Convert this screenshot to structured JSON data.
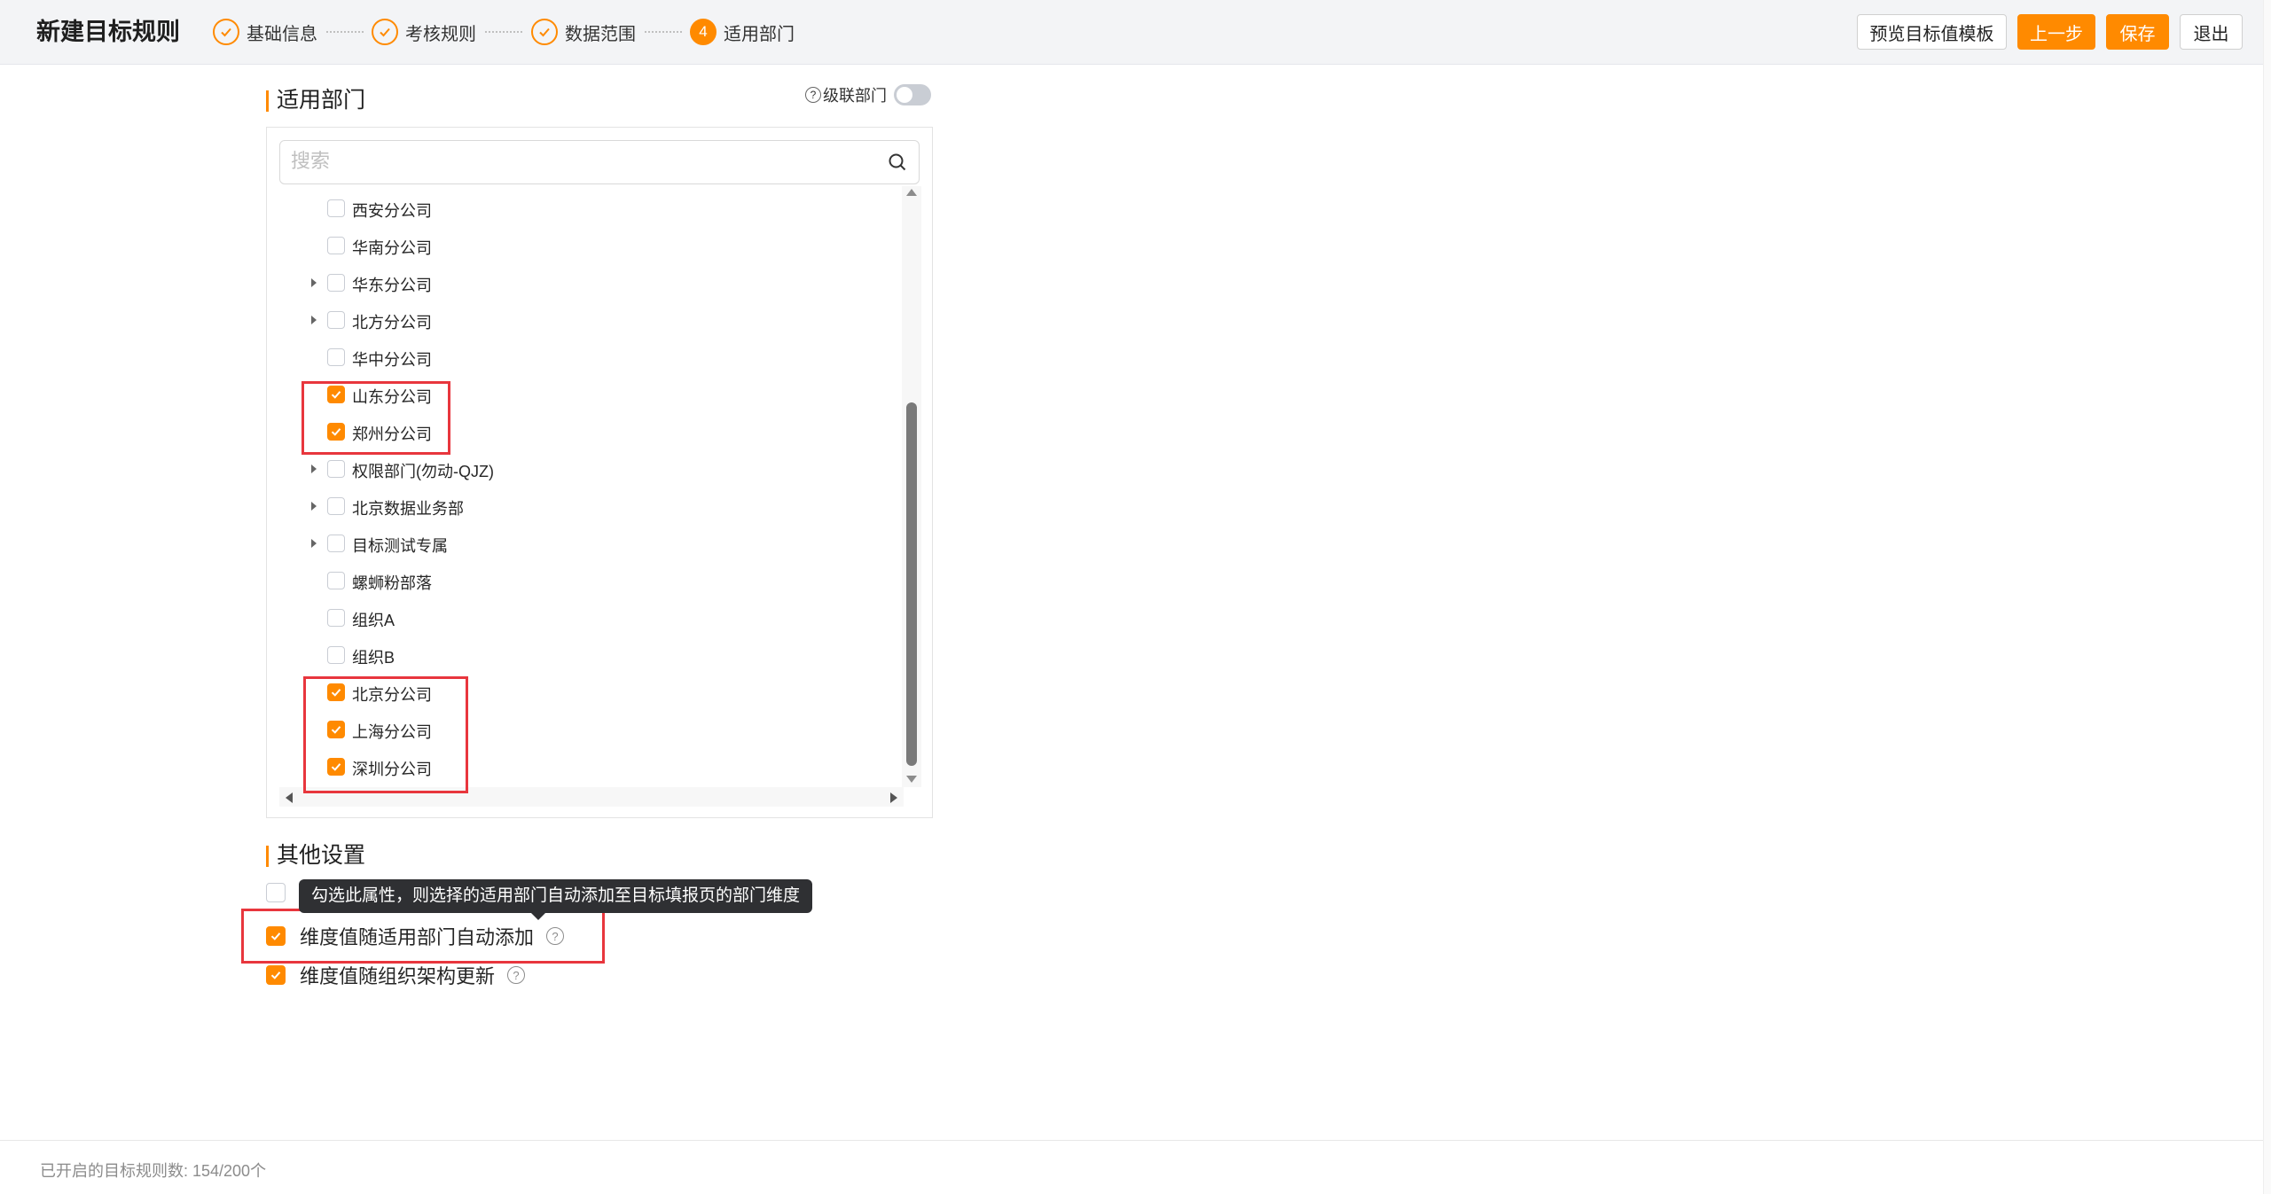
{
  "header": {
    "title": "新建目标规则",
    "steps": [
      {
        "label": "基础信息",
        "state": "done"
      },
      {
        "label": "考核规则",
        "state": "done"
      },
      {
        "label": "数据范围",
        "state": "done"
      },
      {
        "label": "适用部门",
        "state": "active",
        "number": "4"
      }
    ],
    "buttons": {
      "preview": "预览目标值模板",
      "prev": "上一步",
      "save": "保存",
      "exit": "退出"
    }
  },
  "dept_section": {
    "title": "适用部门",
    "cascade_label": "级联部门",
    "cascade_on": false,
    "search_placeholder": "搜索",
    "items": [
      {
        "label": "西安分公司",
        "checked": false,
        "expandable": false
      },
      {
        "label": "华南分公司",
        "checked": false,
        "expandable": false
      },
      {
        "label": "华东分公司",
        "checked": false,
        "expandable": true
      },
      {
        "label": "北方分公司",
        "checked": false,
        "expandable": true
      },
      {
        "label": "华中分公司",
        "checked": false,
        "expandable": false
      },
      {
        "label": "山东分公司",
        "checked": true,
        "expandable": false
      },
      {
        "label": "郑州分公司",
        "checked": true,
        "expandable": false
      },
      {
        "label": "权限部门(勿动-QJZ)",
        "checked": false,
        "expandable": true
      },
      {
        "label": "北京数据业务部",
        "checked": false,
        "expandable": true
      },
      {
        "label": "目标测试专属",
        "checked": false,
        "expandable": true
      },
      {
        "label": "螺蛳粉部落",
        "checked": false,
        "expandable": false
      },
      {
        "label": "组织A",
        "checked": false,
        "expandable": false
      },
      {
        "label": "组织B",
        "checked": false,
        "expandable": false
      },
      {
        "label": "北京分公司",
        "checked": true,
        "expandable": false
      },
      {
        "label": "上海分公司",
        "checked": true,
        "expandable": false
      },
      {
        "label": "深圳分公司",
        "checked": true,
        "expandable": false
      }
    ]
  },
  "other_section": {
    "title": "其他设置",
    "tooltip": "勾选此属性，则选择的适用部门自动添加至目标填报页的部门维度",
    "settings": [
      {
        "label": "",
        "checked": false
      },
      {
        "label": "维度值随适用部门自动添加",
        "checked": true
      },
      {
        "label": "维度值随组织架构更新",
        "checked": true
      }
    ]
  },
  "footer": {
    "text": "已开启的目标规则数: 154/200个"
  },
  "colors": {
    "accent": "#ff8a00",
    "highlight": "#e8363d"
  }
}
